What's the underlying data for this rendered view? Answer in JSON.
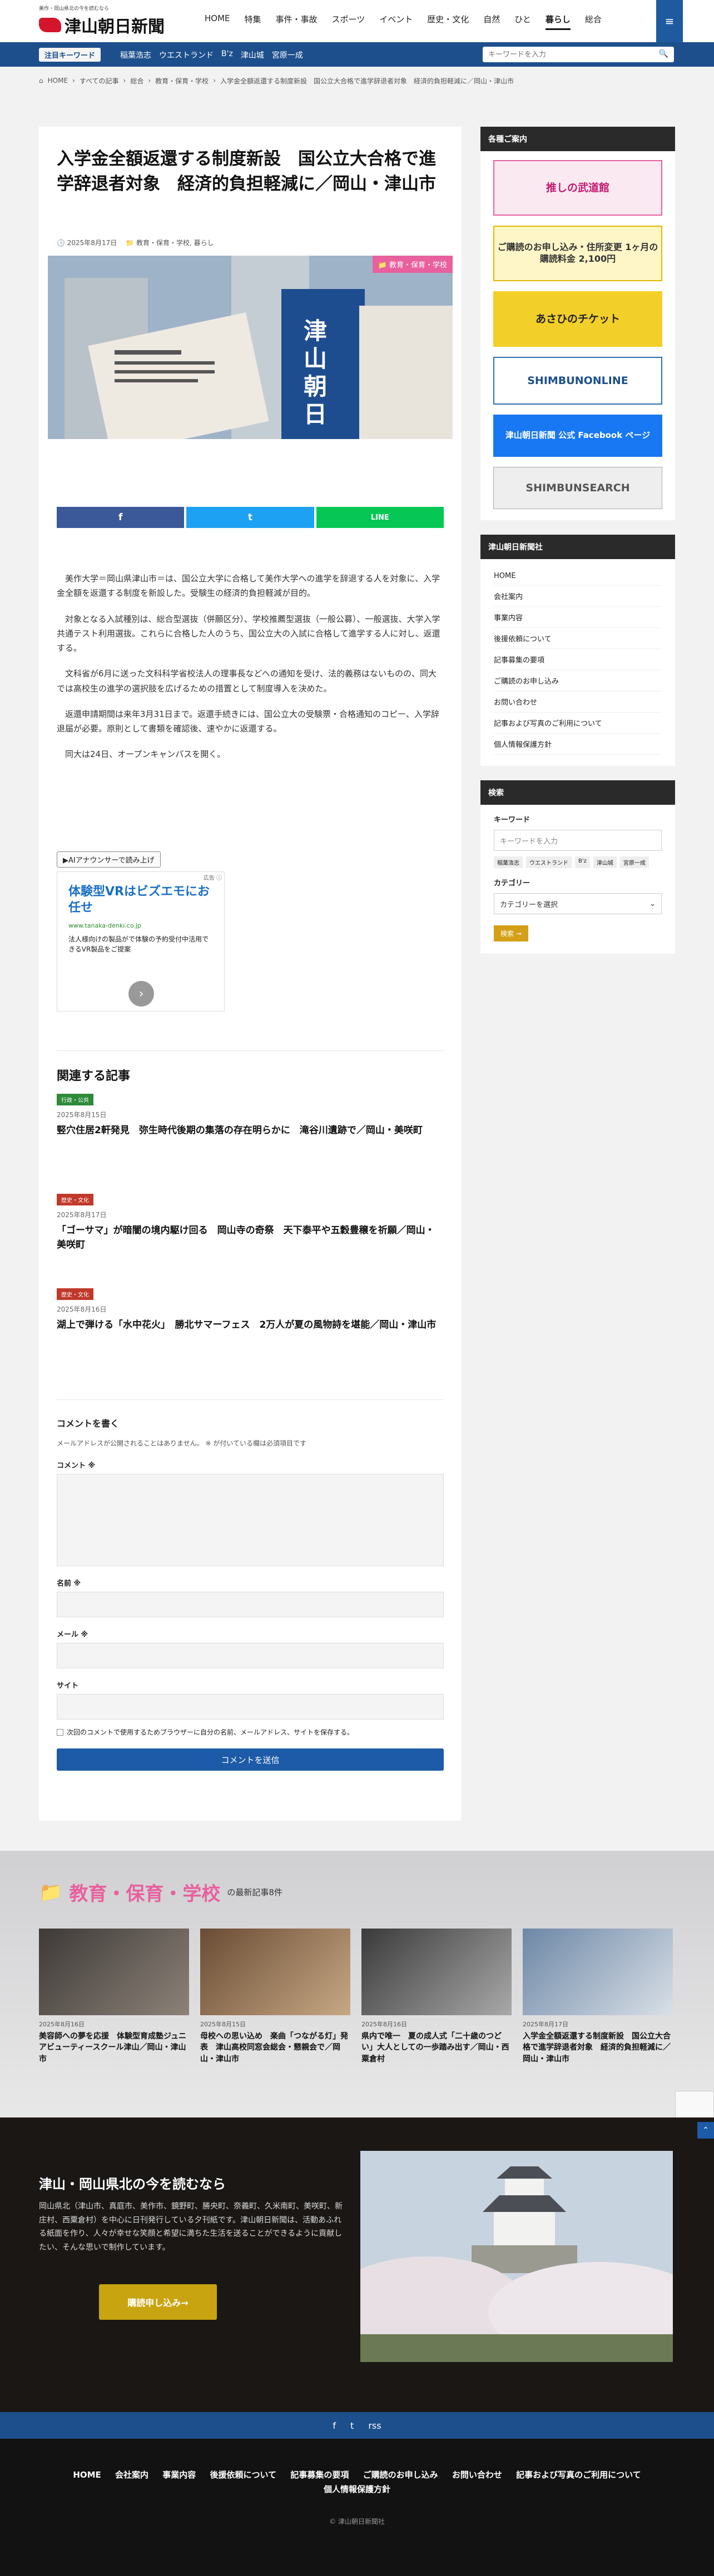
{
  "header": {
    "tagline": "美作・岡山県北の今を読むなら",
    "logo": "津山朝日新聞",
    "nav": [
      "HOME",
      "特集",
      "事件・事故",
      "スポーツ",
      "イベント",
      "歴史・文化",
      "自然",
      "ひと",
      "暮らし",
      "総合"
    ],
    "active_nav": "暮らし",
    "menu_icon": "≡"
  },
  "topicbar": {
    "label": "注目キーワード",
    "keywords": [
      "稲葉浩志",
      "ウエストランド",
      "B'z",
      "津山城",
      "宮原一成"
    ],
    "search_placeholder": "キーワードを入力",
    "search_icon": "🔍"
  },
  "breadcrumb": [
    "HOME",
    "すべての記事",
    "総合",
    "教育・保育・学校",
    "入学金全額返還する制度新設　国公立大合格で進学辞退者対象　経済的負担軽減に／岡山・津山市"
  ],
  "article": {
    "title": "入学金全額返還する制度新設　国公立大合格で進学辞退者対象　経済的負担軽減に／岡山・津山市",
    "date": "2025年8月17日",
    "categories": "教育・保育・学校, 暮らし",
    "badge": "教育・保育・学校",
    "share": {
      "facebook": "f",
      "twitter": "t",
      "line": "LINE"
    },
    "paragraphs": [
      "美作大学＝岡山県津山市＝は、国公立大学に合格して美作大学への進学を辞退する人を対象に、入学金全額を返還する制度を新設した。受験生の経済的負担軽減が目的。",
      "対象となる入試種別は、総合型選抜（併願区分）、学校推薦型選抜（一般公募）、一般選抜、大学入学共通テスト利用選抜。これらに合格した人のうち、国公立大の入試に合格して進学する人に対し、返還する。",
      "文科省が6月に送った文科科学省校法人の理事長などへの通知を受け、法的義務はないものの、同大では高校生の進学の選択肢を広げるための措置として制度導入を決めた。",
      "返還申請期間は来年3月31日まで。返還手続きには、国公立大の受験票・合格通知のコピー、入学辞退届が必要。原則として書類を確認後、速やかに返還する。",
      "同大は24日、オープンキャンパスを開く。"
    ],
    "listen_label": "▶AIアナウンサーで読み上げ"
  },
  "ad": {
    "title": "体験型VRはビズエモにお任せ",
    "url": "www.tanaka-denki.co.jp",
    "desc": "法人様向けの製品がで体験の予約受付中活用できるVR製品をご提案",
    "mark": "広告 ⓘ",
    "arrow": "›"
  },
  "related": {
    "heading": "関連する記事",
    "items": [
      {
        "badge": "行政・公共",
        "date": "2025年8月15日",
        "title": "竪穴住居2軒発見　弥生時代後期の集落の存在明らかに　滝谷川遺跡で／岡山・美咲町",
        "color": "#2e8b3a"
      },
      {
        "badge": "歴史・文化",
        "date": "2025年8月17日",
        "title": "「ゴーサマ」が暗闇の境内駆け回る　岡山寺の奇祭　天下泰平や五穀豊穣を祈願／岡山・美咲町",
        "color": "#c0392b"
      },
      {
        "badge": "歴史・文化",
        "date": "2025年8月16日",
        "title": "湖上で弾ける「水中花火」　勝北サマーフェス　2万人が夏の風物詩を堪能／岡山・津山市",
        "color": "#c0392b"
      }
    ]
  },
  "comment": {
    "heading": "コメントを書く",
    "note": "メールアドレスが公開されることはありません。 ※ が付いている欄は必須項目です",
    "comment_label": "コメント ※",
    "name_label": "名前 ※",
    "email_label": "メール ※",
    "site_label": "サイト",
    "remember": "次回のコメントで使用するためブラウザーに自分の名前、メールアドレス、サイトを保存する。",
    "submit": "コメントを送信"
  },
  "sidebar": {
    "ads_heading": "各種ご案内",
    "banners": [
      "推しの武道館",
      "ご購読のお申し込み・住所変更 1ヶ月の購読料金 2,100円",
      "あさひのチケット",
      "SHIMBUNONLINE",
      "津山朝日新聞 公式 Facebook ページ",
      "SHIMBUNSEARCH"
    ],
    "company_heading": "津山朝日新聞社",
    "company_links": [
      "HOME",
      "会社案内",
      "事業内容",
      "後援依頼について",
      "記事募集の要項",
      "ご購読のお申し込み",
      "お問い合わせ",
      "記事および写真のご利用について",
      "個人情報保護方針"
    ],
    "search_heading": "検索",
    "keyword_label": "キーワード",
    "keyword_placeholder": "キーワードを入力",
    "tags": [
      "稲葉浩志",
      "ウエストランド",
      "B'z",
      "津山城",
      "宮原一成"
    ],
    "category_label": "カテゴリー",
    "category_select": "カテゴリーを選択",
    "search_button": "検索 →"
  },
  "lower": {
    "heading": "教育・保育・学校",
    "sub": "の最新記事8件",
    "cards": [
      {
        "date": "2025年8月16日",
        "title": "美容師への夢を応援　体験型育成塾ジュニアビューティースクール津山／岡山・津山市"
      },
      {
        "date": "2025年8月15日",
        "title": "母校への思い込め　楽曲「つながる灯」発表　津山高校同窓会総会・懇親会で／岡山・津山市"
      },
      {
        "date": "2025年8月16日",
        "title": "県内で唯一　夏の成人式「二十歳のつどい」大人としての一歩踏み出す／岡山・西粟倉村"
      },
      {
        "date": "2025年8月17日",
        "title": "入学金全額返還する制度新設　国公立大合格で進学辞退者対象　経済的負担軽減に／岡山・津山市"
      }
    ]
  },
  "promo": {
    "heading": "津山・岡山県北の今を読むなら",
    "text": "岡山県北（津山市、真庭市、美作市、鏡野町、勝央町、奈義町、久米南町、美咲町、新庄村、西粟倉村）を中心に日刊発行している夕刊紙です。津山朝日新聞は、活動あふれる紙面を作り、人々が幸せな笑顔と希望に満ちた生活を送ることができるように貢献したい、そんな思いで制作しています。",
    "button": "購読申し込み→"
  },
  "social": [
    "f",
    "t",
    "rss"
  ],
  "footer": {
    "nav": [
      "HOME",
      "会社案内",
      "事業内容",
      "後援依頼について",
      "記事募集の要項",
      "ご購読のお申し込み",
      "お問い合わせ",
      "記事および写真のご利用について",
      "個人情報保護方針"
    ],
    "copy": "© 津山朝日新聞社"
  }
}
